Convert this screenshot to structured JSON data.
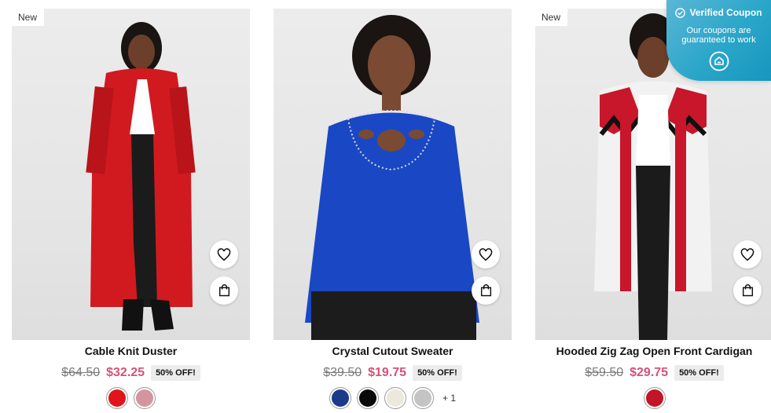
{
  "products": [
    {
      "name": "Cable Knit Duster",
      "badge": "New",
      "original_price": "$64.50",
      "sale_price": "$32.25",
      "discount": "50% OFF!",
      "swatches": [
        "#e0141b",
        "#d4969c"
      ],
      "extra_colors": ""
    },
    {
      "name": "Crystal Cutout Sweater",
      "badge": "",
      "original_price": "$39.50",
      "sale_price": "$19.75",
      "discount": "50% OFF!",
      "swatches": [
        "#1c3a8c",
        "#0a0a0a",
        "#ece9dc",
        "#c4c4c4"
      ],
      "extra_colors": "+ 1"
    },
    {
      "name": "Hooded Zig Zag Open Front Cardigan",
      "badge": "New",
      "original_price": "$59.50",
      "sale_price": "$29.75",
      "discount": "50% OFF!",
      "swatches": [
        "#c21525"
      ],
      "extra_colors": ""
    }
  ],
  "coupon": {
    "title": "Verified Coupon",
    "subtitle": "Our coupons are guaranteed to work"
  },
  "icons": {
    "wishlist": "heart-icon",
    "add_to_bag": "shopping-bag-icon",
    "verified": "check-circle-icon",
    "coupon_logo": "coupon-logo-icon"
  },
  "colors": {
    "sale_price": "#d4527a",
    "coupon_bg": "#2aa6c9"
  }
}
